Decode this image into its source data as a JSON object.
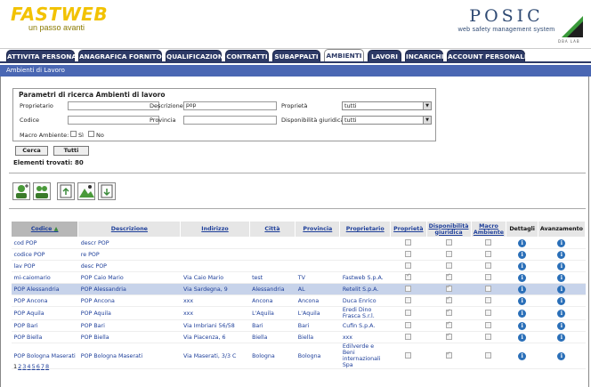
{
  "brand": {
    "logo": "FASTWEB",
    "slogan": "un passo avanti",
    "product": "POSIC",
    "product_sub": "web safety management system",
    "partner": "DBA LAB"
  },
  "tabs": [
    {
      "label": "ATTIVITA PERSONALI"
    },
    {
      "label": "ANAGRAFICA FORNITORI"
    },
    {
      "label": "QUALIFICAZIONI"
    },
    {
      "label": "CONTRATTI"
    },
    {
      "label": "SUBAPPALTI"
    },
    {
      "label": "AMBIENTI"
    },
    {
      "label": "LAVORI"
    },
    {
      "label": "INCARICHI"
    },
    {
      "label": "ACCOUNT PERSONALE"
    }
  ],
  "section_title": "Ambienti di Lavoro",
  "search": {
    "title": "Parametri di ricerca Ambienti di lavoro",
    "proprietario_label": "Proprietario",
    "proprietario_value": "",
    "descrizione_label": "Descrizione",
    "descrizione_value": "pop",
    "proprieta_label": "Proprietà",
    "proprieta_value": "tutti",
    "codice_label": "Codice",
    "codice_value": "",
    "provincia_label": "Provincia",
    "provincia_value": "",
    "disponibilita_label": "Disponibilità giuridica",
    "disponibilita_value": "tutti",
    "macro_label": "Macro Ambiente:",
    "si_label": "Sì",
    "no_label": "No",
    "cerca_label": "Cerca",
    "tutti_label": "Tutti"
  },
  "found_text": "Elementi trovati: 80",
  "toolbar": [
    "add-person-icon",
    "add-person-group-icon",
    "upload-document-icon",
    "upload-map-icon",
    "download-document-icon"
  ],
  "grid": {
    "headers": [
      "Codice",
      "Descrizione",
      "Indirizzo",
      "Città",
      "Provincia",
      "Proprietario",
      "Proprietà",
      "Disponibilità giuridica",
      "Macro Ambiente",
      "Dettagli",
      "Avanzamento"
    ],
    "rows": [
      {
        "codice": "cod POP",
        "descrizione": "descr POP",
        "indirizzo": "",
        "citta": "",
        "provincia": "",
        "proprietario": "",
        "prop": false,
        "disp": false,
        "macro": false
      },
      {
        "codice": "codice POP",
        "descrizione": "re POP",
        "indirizzo": "",
        "citta": "",
        "provincia": "",
        "proprietario": "",
        "prop": false,
        "disp": false,
        "macro": false
      },
      {
        "codice": "lav POP",
        "descrizione": "desc POP",
        "indirizzo": "",
        "citta": "",
        "provincia": "",
        "proprietario": "",
        "prop": false,
        "disp": false,
        "macro": false
      },
      {
        "codice": "mi-caiomario",
        "descrizione": "POP Caio Mario",
        "indirizzo": "Via Caio Mario",
        "citta": "test",
        "provincia": "TV",
        "proprietario": "Fastweb S.p.A.",
        "prop": true,
        "disp": true,
        "macro": false
      },
      {
        "codice": "POP Alessandria",
        "descrizione": "POP Alessandria",
        "indirizzo": "Via Sardegna, 9",
        "citta": "Alessandria",
        "provincia": "AL",
        "proprietario": "Retelit S.p.A.",
        "prop": false,
        "disp": true,
        "macro": false,
        "highlight": true
      },
      {
        "codice": "POP Ancona",
        "descrizione": "POP Ancona",
        "indirizzo": "xxx",
        "citta": "Ancona",
        "provincia": "Ancona",
        "proprietario": "Duca Enrico",
        "prop": false,
        "disp": true,
        "macro": false
      },
      {
        "codice": "POP Aquila",
        "descrizione": "POP Aquila",
        "indirizzo": "xxx",
        "citta": "L'Aquila",
        "provincia": "L'Aquila",
        "proprietario": "Eredi Dino Frasca S.r.l.",
        "prop": false,
        "disp": true,
        "macro": false
      },
      {
        "codice": "POP Bari",
        "descrizione": "POP Bari",
        "indirizzo": "Via Imbriani 56/58",
        "citta": "Bari",
        "provincia": "Bari",
        "proprietario": "Cufin S.p.A.",
        "prop": false,
        "disp": true,
        "macro": false
      },
      {
        "codice": "POP Biella",
        "descrizione": "POP Biella",
        "indirizzo": "Via Piacenza, 6",
        "citta": "Biella",
        "provincia": "Biella",
        "proprietario": "xxx",
        "prop": false,
        "disp": true,
        "macro": false
      },
      {
        "codice": "POP Bologna Maserati",
        "descrizione": "POP Bologna Maserati",
        "indirizzo": "Via Maserati, 3/3 C",
        "citta": "Bologna",
        "provincia": "Bologna",
        "proprietario": "Edilverde e Beni internazionali Spa",
        "prop": false,
        "disp": true,
        "macro": false
      }
    ]
  },
  "pager": [
    "1",
    "2",
    "3",
    "4",
    "5",
    "6",
    "7",
    "8"
  ],
  "colors": {
    "tab": "#2d3a66",
    "section": "#4a67b3",
    "highlight": "#c7d3ea",
    "link": "#1e3f9a",
    "logo": "#f2c200"
  }
}
